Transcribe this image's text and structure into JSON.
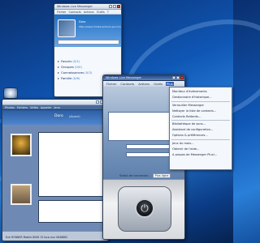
{
  "contacts_window": {
    "title": "Windows Live Messenger",
    "menu": [
      "Fichier",
      "Contacts",
      "Actions",
      "Outils",
      "?"
    ],
    "user_name": "Doro",
    "user_url": "http://www.christe-antonin-ps.com/",
    "groups": [
      {
        "label": "Favoris",
        "count": "(0/1)"
      },
      {
        "label": "Groupes",
        "count": "(0/0)"
      },
      {
        "label": "Connaissances",
        "count": "(0/3)"
      },
      {
        "label": "Famille",
        "count": "(0/6)"
      }
    ]
  },
  "chat_window": {
    "menu": [
      "Photos",
      "Fichiers",
      "Vidéo",
      "Appeler",
      "Jeux"
    ],
    "contact_name": "Doro",
    "contact_status": "(Absent)",
    "status_text": "Eve RONNER Mobile 8008 15 tous aux 0848882"
  },
  "messenger_window": {
    "title": "Windows Live Messenger",
    "menu": [
      "Fichier",
      "Contacts",
      "Actions",
      "Outils",
      "Plus"
    ],
    "active_menu": "Plus",
    "status_label": "Statut de connexion :",
    "status_value": "Plus ligne"
  },
  "plus_menu": {
    "items": [
      "Moniteur d'événements",
      "Gestionnaire d'historique...",
      "---",
      "Verrouiller Messenger",
      "Nettoyer la liste de contacts...",
      "Contacts flottants...",
      "---",
      "Bibliothèque de sons...",
      "Assistant de configuration...",
      "Options & préférences...",
      "---",
      "Jeux du mois...",
      "Obtenir de l'aide...",
      "A propos de Messenger Plus!..."
    ]
  },
  "colors": {
    "desktop": "#0f56b4",
    "menu_highlight": "#2f63b5",
    "group_text": "#0d2c6c"
  }
}
